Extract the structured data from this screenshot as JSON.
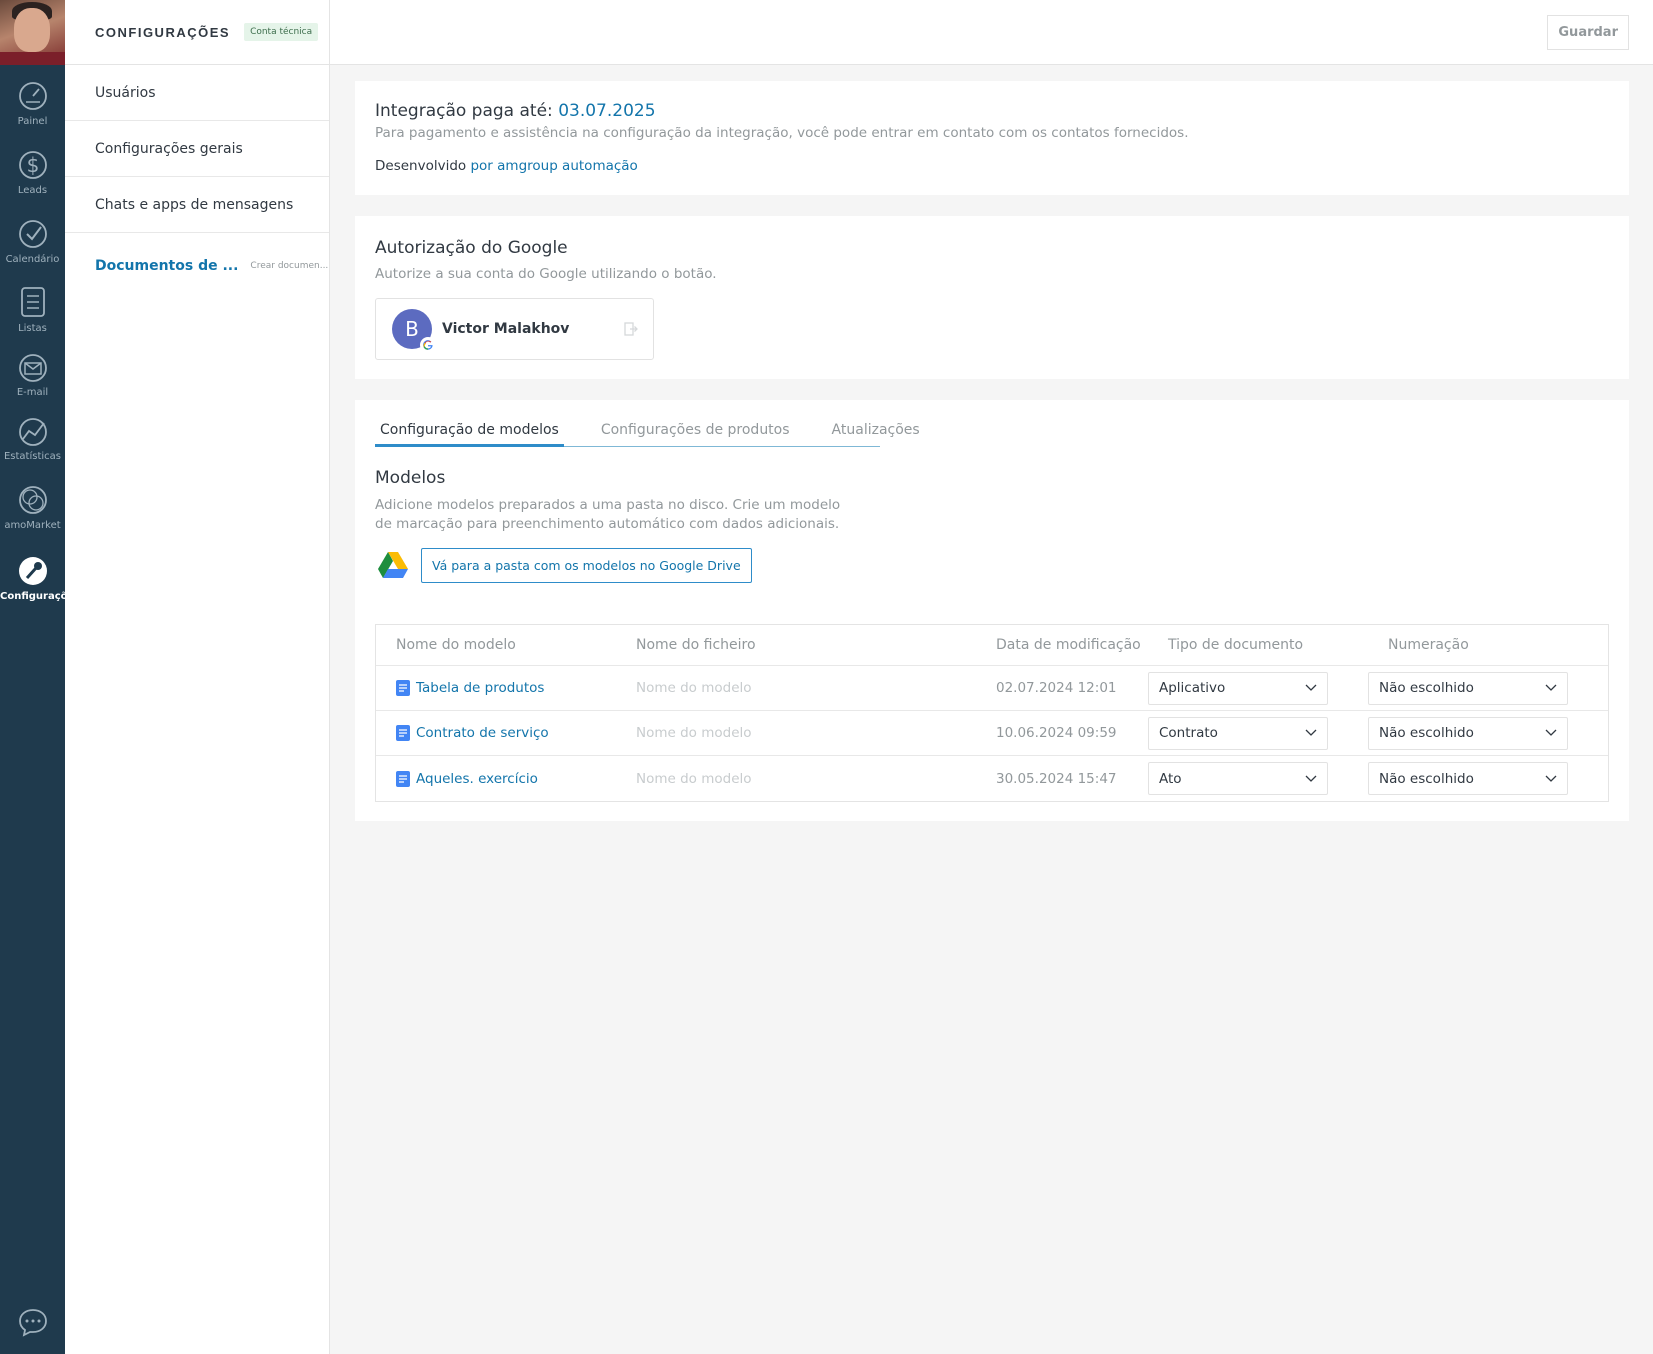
{
  "rail": {
    "items": [
      {
        "label": "Painel",
        "icon": "gauge-icon"
      },
      {
        "label": "Leads",
        "icon": "dollar-icon"
      },
      {
        "label": "Calendário",
        "icon": "checkmark-icon"
      },
      {
        "label": "Listas",
        "icon": "list-icon"
      },
      {
        "label": "E-mail",
        "icon": "envelope-icon"
      },
      {
        "label": "Estatísticas",
        "icon": "chart-icon"
      },
      {
        "label": "amoMarket",
        "icon": "circles-icon"
      },
      {
        "label": "Configurações",
        "icon": "wrench-icon"
      }
    ]
  },
  "sidebar": {
    "title": "CONFIGURAÇÕES",
    "badge": "Conta técnica",
    "items": [
      {
        "label": "Usuários"
      },
      {
        "label": "Configurações gerais"
      },
      {
        "label": "Chats e apps de mensagens"
      },
      {
        "label": "Documentos de ...",
        "sub": "Crear documen..."
      }
    ]
  },
  "topbar": {
    "save_label": "Guardar"
  },
  "integration": {
    "title": "Integração paga até:",
    "date": "03.07.2025",
    "description": "Para pagamento e assistência na configuração da integração, você pode entrar em contato com os contatos fornecidos.",
    "dev_prefix": "Desenvolvido",
    "dev_link": "por amgroup automação"
  },
  "google_auth": {
    "title": "Autorização do Google",
    "subtitle": "Autorize a sua conta do Google utilizando o botão.",
    "account_initial": "B",
    "account_name": "Victor Malakhov"
  },
  "tabs": [
    {
      "label": "Configuração de modelos",
      "active": true
    },
    {
      "label": "Configurações de produtos",
      "active": false
    },
    {
      "label": "Atualizações",
      "active": false
    }
  ],
  "models": {
    "title": "Modelos",
    "desc_line1": "Adicione modelos preparados a uma pasta no disco. Crie um modelo",
    "desc_line2": "de marcação para preenchimento automático com dados adicionais.",
    "drive_button": "Vá para a pasta com os modelos no Google Drive"
  },
  "table": {
    "headers": [
      "Nome do modelo",
      "Nome do ficheiro",
      "Data de modificação",
      "Tipo de documento",
      "Numeração"
    ],
    "rows": [
      {
        "name": "Tabela de produtos",
        "file_placeholder": "Nome do modelo",
        "date": "02.07.2024 12:01",
        "type": "Aplicativo",
        "numbering": "Não escolhido"
      },
      {
        "name": "Contrato de serviço",
        "file_placeholder": "Nome do modelo",
        "date": "10.06.2024 09:59",
        "type": "Contrato",
        "numbering": "Não escolhido"
      },
      {
        "name": "Aqueles. exercício",
        "file_placeholder": "Nome do modelo",
        "date": "30.05.2024 15:47",
        "type": "Ato",
        "numbering": "Não escolhido"
      }
    ]
  },
  "colors": {
    "rail_bg": "#1f3a4d",
    "link": "#1375ab",
    "accent": "#2e8cc9",
    "badge_bg": "#e5f4e9"
  }
}
